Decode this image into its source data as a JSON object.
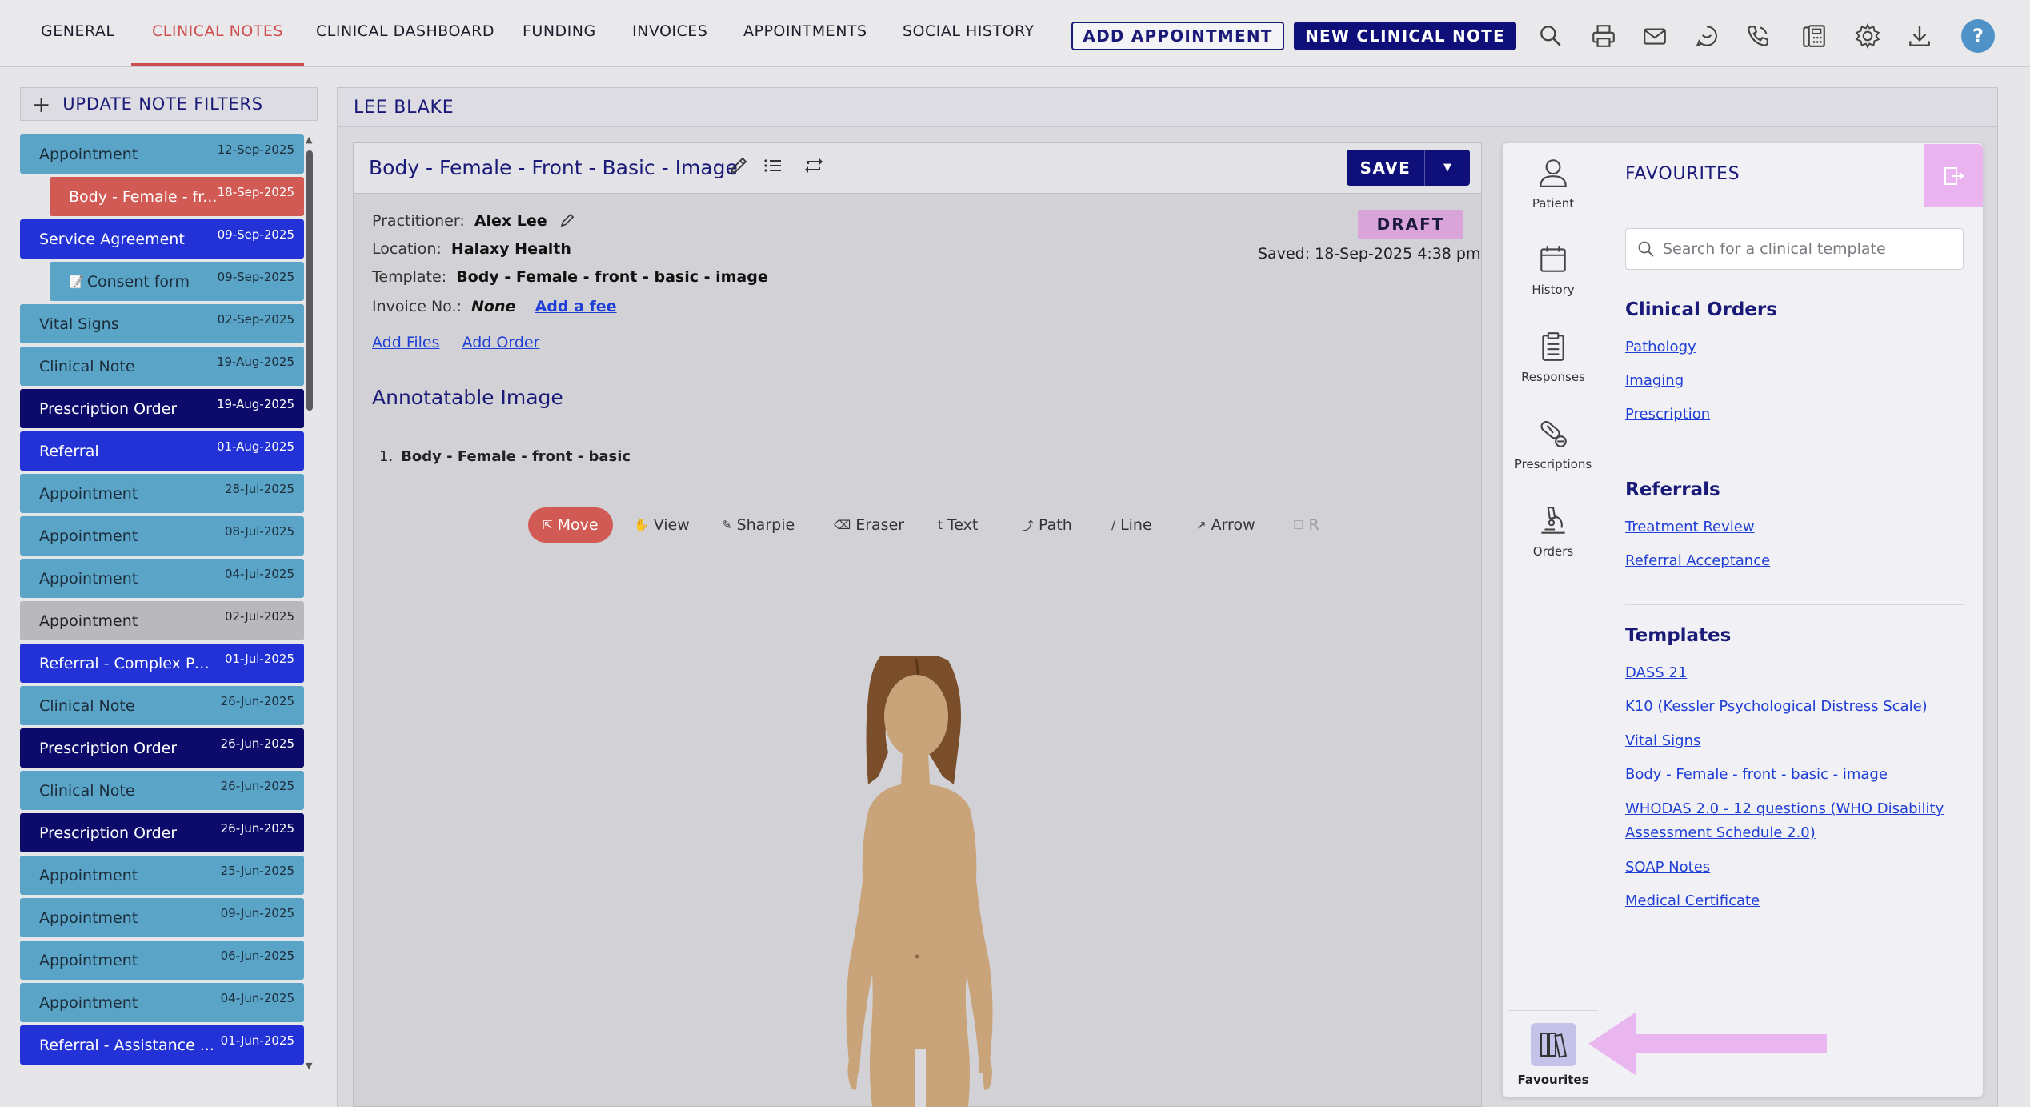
{
  "nav": {
    "tabs": [
      "GENERAL",
      "CLINICAL NOTES",
      "CLINICAL DASHBOARD",
      "FUNDING",
      "INVOICES",
      "APPOINTMENTS",
      "SOCIAL HISTORY"
    ],
    "active_tab": "CLINICAL NOTES",
    "add_appointment": "ADD APPOINTMENT",
    "new_clinical_note": "NEW CLINICAL NOTE",
    "help": "?"
  },
  "sidebar": {
    "filters_label": "UPDATE NOTE FILTERS",
    "notes": [
      {
        "label": "Appointment",
        "date": "12-Sep-2025",
        "color": "light"
      },
      {
        "label": "Body - Female - fr...",
        "date": "18-Sep-2025",
        "color": "red",
        "indent": true
      },
      {
        "label": "Service Agreement",
        "date": "09-Sep-2025",
        "color": "blue"
      },
      {
        "label": "Consent form",
        "date": "09-Sep-2025",
        "color": "light",
        "indent": true,
        "icon": "document-icon"
      },
      {
        "label": "Vital Signs",
        "date": "02-Sep-2025",
        "color": "light"
      },
      {
        "label": "Clinical Note",
        "date": "19-Aug-2025",
        "color": "light"
      },
      {
        "label": "Prescription Order",
        "date": "19-Aug-2025",
        "color": "navy"
      },
      {
        "label": "Referral",
        "date": "01-Aug-2025",
        "color": "blue"
      },
      {
        "label": "Appointment",
        "date": "28-Jul-2025",
        "color": "light"
      },
      {
        "label": "Appointment",
        "date": "08-Jul-2025",
        "color": "light"
      },
      {
        "label": "Appointment",
        "date": "04-Jul-2025",
        "color": "light"
      },
      {
        "label": "Appointment",
        "date": "02-Jul-2025",
        "color": "gray"
      },
      {
        "label": "Referral - Complex Per...",
        "date": "01-Jul-2025",
        "color": "blue"
      },
      {
        "label": "Clinical Note",
        "date": "26-Jun-2025",
        "color": "light"
      },
      {
        "label": "Prescription Order",
        "date": "26-Jun-2025",
        "color": "navy"
      },
      {
        "label": "Clinical Note",
        "date": "26-Jun-2025",
        "color": "light"
      },
      {
        "label": "Prescription Order",
        "date": "26-Jun-2025",
        "color": "navy"
      },
      {
        "label": "Appointment",
        "date": "25-Jun-2025",
        "color": "light"
      },
      {
        "label": "Appointment",
        "date": "09-Jun-2025",
        "color": "light"
      },
      {
        "label": "Appointment",
        "date": "06-Jun-2025",
        "color": "light"
      },
      {
        "label": "Appointment",
        "date": "04-Jun-2025",
        "color": "light"
      },
      {
        "label": "Referral - Assistance ...",
        "date": "01-Jun-2025",
        "color": "blue"
      }
    ]
  },
  "patient": {
    "name": "LEE BLAKE"
  },
  "note": {
    "title": "Body - Female - Front - Basic - Image",
    "save_label": "SAVE",
    "status": "DRAFT",
    "saved": "Saved: 18-Sep-2025 4:38 pm",
    "practitioner_label": "Practitioner:",
    "practitioner": "Alex Lee",
    "location_label": "Location:",
    "location": "Halaxy Health",
    "template_label": "Template:",
    "template": "Body - Female - front - basic - image",
    "invoice_label": "Invoice No.:",
    "invoice": "None",
    "add_fee": "Add a fee",
    "add_files": "Add Files",
    "add_order": "Add Order",
    "section_title": "Annotatable Image",
    "image_index": "1.",
    "image_name": "Body - Female - front - basic",
    "tools": [
      "Move",
      "View",
      "Sharpie",
      "Eraser",
      "Text",
      "Path",
      "Line",
      "Arrow",
      "R"
    ]
  },
  "rail": {
    "items": [
      "Patient",
      "History",
      "Responses",
      "Prescriptions",
      "Orders"
    ],
    "favourites": "Favourites"
  },
  "favourites": {
    "title": "FAVOURITES",
    "search_placeholder": "Search for a clinical template",
    "groups": [
      {
        "title": "Clinical Orders",
        "links": [
          "Pathology",
          "Imaging",
          "Prescription"
        ]
      },
      {
        "title": "Referrals",
        "links": [
          "Treatment Review",
          "Referral Acceptance"
        ]
      },
      {
        "title": "Templates",
        "links": [
          "DASS 21",
          "K10 (Kessler Psychological Distress Scale)",
          "Vital Signs",
          "Body - Female - front - basic - image",
          "WHODAS 2.0 - 12 questions (WHO Disability",
          "Assessment Schedule 2.0)",
          "SOAP Notes",
          "Medical Certificate"
        ]
      }
    ]
  },
  "colors": {
    "accent_navy": "#0f0f7a",
    "active_red": "#cf4d4d",
    "link_blue": "#1f3ed6",
    "highlight_pink": "#e9b4ef"
  }
}
